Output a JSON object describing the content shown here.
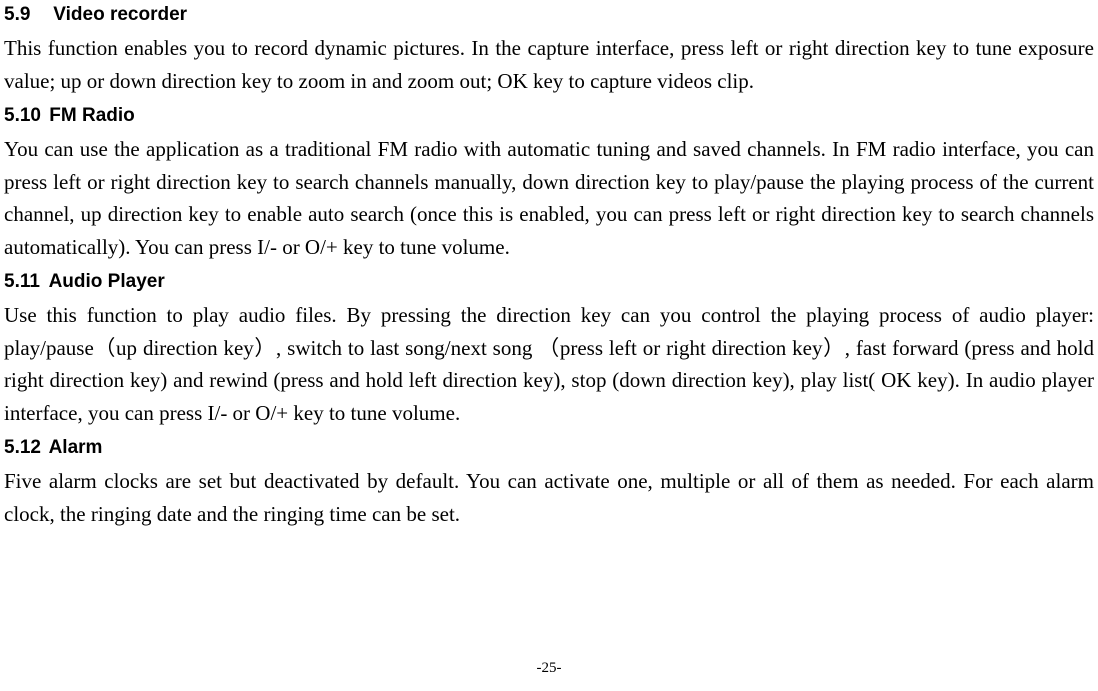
{
  "sections": [
    {
      "num": "5.9",
      "title": "Video recorder",
      "body": "This function enables you to record dynamic pictures. In the capture interface, press left or right direction key to tune exposure value; up or down direction key to zoom in and zoom out; OK key to capture videos clip."
    },
    {
      "num": "5.10",
      "title": "FM Radio",
      "body": "You can use the application as a traditional FM radio with automatic tuning and saved channels. In FM radio interface, you can press left or right direction key to search channels manually, down direction key to play/pause the playing process of the current channel, up direction key to enable auto search (once this is enabled, you can press left or right direction key to search channels automatically). You can press I/- or O/+ key to tune volume."
    },
    {
      "num": "5.11",
      "title": "Audio Player",
      "body": "Use this function to play audio files. By pressing the direction key can you control the playing process of audio player: play/pause（up direction key）, switch to last song/next song （press left or right direction key）, fast forward (press and hold right direction key) and rewind (press and hold left direction key), stop (down direction key), play list( OK key). In audio player interface, you can press I/- or O/+ key to tune volume."
    },
    {
      "num": "5.12",
      "title": "Alarm",
      "body": "Five alarm clocks are set but deactivated by default. You can activate one, multiple or all of them as needed. For each alarm clock, the ringing date and the ringing time can be set."
    }
  ],
  "page_number": "-25-"
}
